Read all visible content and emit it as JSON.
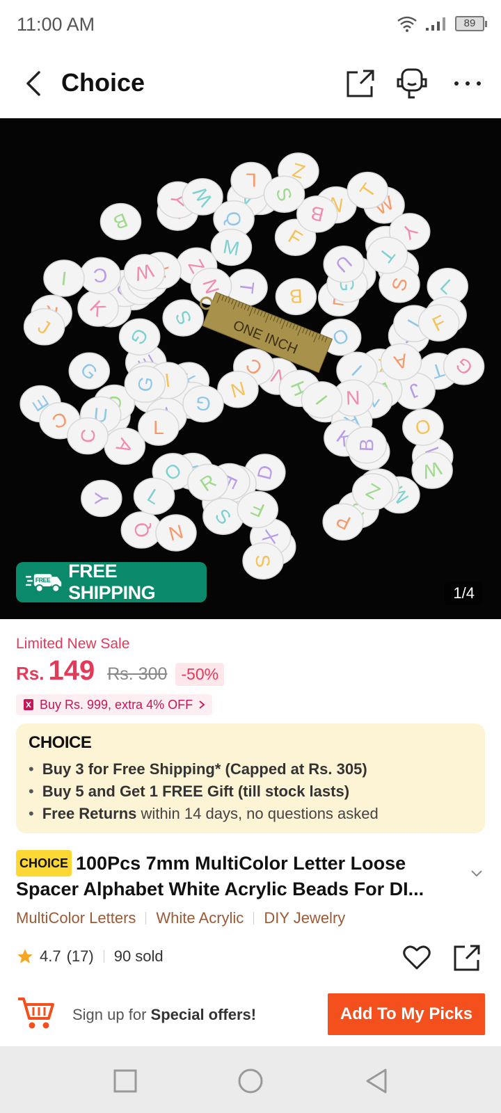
{
  "status_bar": {
    "time": "11:00 AM",
    "battery": "89"
  },
  "header": {
    "title": "Choice"
  },
  "hero": {
    "free_shipping_label": "FREE SHIPPING",
    "free_tag": "FREE",
    "counter": "1/4",
    "ruler_text": "ONE  INCH"
  },
  "price": {
    "sale_label": "Limited New Sale",
    "currency": "Rs.",
    "current": "149",
    "original": "Rs. 300",
    "discount": "-50%",
    "coupon": "Buy Rs. 999, extra 4% OFF"
  },
  "choice": {
    "logo": "CHOICE",
    "benefits": [
      {
        "bold": "Buy 3 for  Free Shipping* (Capped at Rs. 305)",
        "rest": ""
      },
      {
        "bold": "Buy 5 and Get 1 FREE Gift (till stock lasts)",
        "rest": ""
      },
      {
        "bold": "Free Returns",
        "rest": " within 14 days, no questions asked"
      }
    ]
  },
  "product": {
    "badge": "CHOICE",
    "title": "100Pcs 7mm MultiColor Letter Loose Spacer Alphabet White Acrylic Beads For DI...",
    "tags": [
      "MultiColor Letters",
      "White Acrylic",
      "DIY Jewelry"
    ],
    "rating": "4.7",
    "reviews": "(17)",
    "sold": "90 sold"
  },
  "bottom_bar": {
    "signup_prefix": "Sign up for ",
    "signup_bold": "Special offers!",
    "add_button": "Add To My Picks"
  },
  "colors": {
    "accent": "#f4501e",
    "sale": "#e5395a",
    "shipping": "#0a8a6a",
    "choice_bg": "#fdf3d5"
  }
}
